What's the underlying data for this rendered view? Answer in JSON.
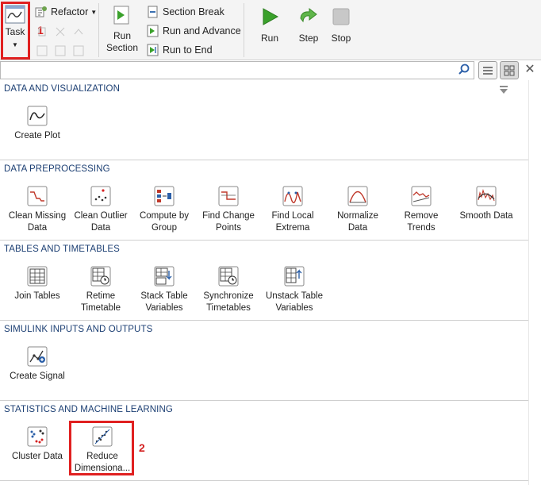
{
  "toolstrip": {
    "task": {
      "label": "Task"
    },
    "refactor": {
      "label": "Refactor"
    },
    "run_section": {
      "line1": "Run",
      "line2": "Section"
    },
    "section_break": {
      "label": "Section Break"
    },
    "run_and_advance": {
      "label": "Run and Advance"
    },
    "run_to_end": {
      "label": "Run to End"
    },
    "run": {
      "label": "Run"
    },
    "step": {
      "label": "Step"
    },
    "stop": {
      "label": "Stop"
    }
  },
  "annotations": {
    "one": "1",
    "two": "2"
  },
  "search": {
    "placeholder": "",
    "value": ""
  },
  "gallery": {
    "sections": [
      {
        "title": "DATA AND VISUALIZATION",
        "items": [
          {
            "l1": "Create Plot",
            "l2": "",
            "icon": "create-plot-icon"
          }
        ]
      },
      {
        "title": "DATA PREPROCESSING",
        "items": [
          {
            "l1": "Clean Missing",
            "l2": "Data",
            "icon": "clean-missing-data-icon"
          },
          {
            "l1": "Clean Outlier",
            "l2": "Data",
            "icon": "clean-outlier-data-icon"
          },
          {
            "l1": "Compute by",
            "l2": "Group",
            "icon": "compute-by-group-icon"
          },
          {
            "l1": "Find Change",
            "l2": "Points",
            "icon": "find-change-points-icon"
          },
          {
            "l1": "Find Local",
            "l2": "Extrema",
            "icon": "find-local-extrema-icon"
          },
          {
            "l1": "Normalize",
            "l2": "Data",
            "icon": "normalize-data-icon"
          },
          {
            "l1": "Remove",
            "l2": "Trends",
            "icon": "remove-trends-icon"
          },
          {
            "l1": "Smooth Data",
            "l2": "",
            "icon": "smooth-data-icon"
          }
        ]
      },
      {
        "title": "TABLES AND TIMETABLES",
        "items": [
          {
            "l1": "Join Tables",
            "l2": "",
            "icon": "join-tables-icon"
          },
          {
            "l1": "Retime",
            "l2": "Timetable",
            "icon": "retime-timetable-icon"
          },
          {
            "l1": "Stack Table",
            "l2": "Variables",
            "icon": "stack-table-variables-icon"
          },
          {
            "l1": "Synchronize",
            "l2": "Timetables",
            "icon": "synchronize-timetables-icon"
          },
          {
            "l1": "Unstack Table",
            "l2": "Variables",
            "icon": "unstack-table-variables-icon"
          }
        ]
      },
      {
        "title": "SIMULINK INPUTS AND OUTPUTS",
        "items": [
          {
            "l1": "Create Signal",
            "l2": "",
            "icon": "create-signal-icon"
          }
        ]
      },
      {
        "title": "STATISTICS AND MACHINE LEARNING",
        "items": [
          {
            "l1": "Cluster Data",
            "l2": "",
            "icon": "cluster-data-icon"
          },
          {
            "l1": "Reduce",
            "l2": "Dimensiona...",
            "icon": "reduce-dimensionality-icon"
          }
        ]
      }
    ]
  },
  "colors": {
    "accent_red": "#e02020",
    "section_title": "#1c3f73",
    "run_green": "#3aa12b"
  }
}
